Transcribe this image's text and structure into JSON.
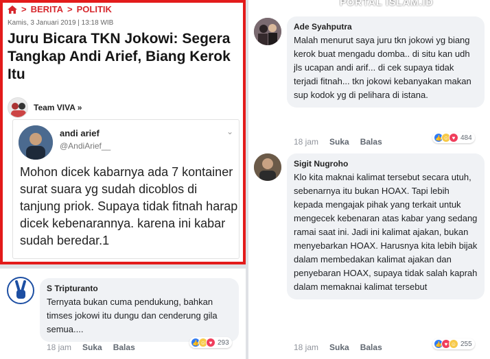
{
  "breadcrumb": {
    "section": "BERITA",
    "subsection": "POLITIK"
  },
  "article": {
    "dateline": "Kamis, 3 Januari 2019 | 13:18 WIB",
    "headline": "Juru Bicara TKN Jokowi: Segera Tangkap Andi Arief, Biang Kerok Itu",
    "author": "Team VIVA »"
  },
  "tweet": {
    "name": "andi arief",
    "handle": "@AndiArief__",
    "text": "Mohon dicek kabarnya ada 7 kontainer surat suara yg sudah dicoblos di tanjung priok. Supaya tidak fitnah harap dicek kebenarannya. karena ini kabar sudah beredar.1"
  },
  "watermark": "PORTAL ISLAM.ID",
  "comments": [
    {
      "name": "S Tripturanto",
      "text": "Ternyata bukan cuma pendukung, bahkan timses jokowi itu dungu dan cenderung gila semua....",
      "time": "18 jam",
      "like": "Suka",
      "reply": "Balas",
      "reactions": "293"
    },
    {
      "name": "Ade Syahputra",
      "text": "Malah menurut saya juru tkn jokowi yg biang kerok buat mengadu domba.. di situ kan udh jls ucapan andi arif... di cek supaya tidak terjadi fitnah... tkn jokowi kebanyakan makan sup kodok yg di pelihara di istana.",
      "time": "18 jam",
      "like": "Suka",
      "reply": "Balas",
      "reactions": "484"
    },
    {
      "name": "Sigit Nugroho",
      "text": "Klo kita maknai kalimat tersebut secara utuh, sebenarnya itu bukan HOAX. Tapi lebih kepada mengajak pihak yang terkait untuk mengecek kebenaran atas kabar yang sedang ramai saat ini. Jadi ini kalimat ajakan, bukan menyebarkan HOAX. Harusnya kita lebih bijak dalam membedakan kalimat ajakan dan penyebaran HOAX, supaya tidak salah kaprah dalam memaknai kalimat tersebut",
      "time": "18 jam",
      "like": "Suka",
      "reply": "Balas",
      "reactions": "255"
    }
  ],
  "colors": {
    "highlight_border": "#e31b1b",
    "breadcrumb": "#d6262c",
    "like": "#2e7bf6",
    "love": "#f03e5c",
    "haha": "#f7c948"
  }
}
